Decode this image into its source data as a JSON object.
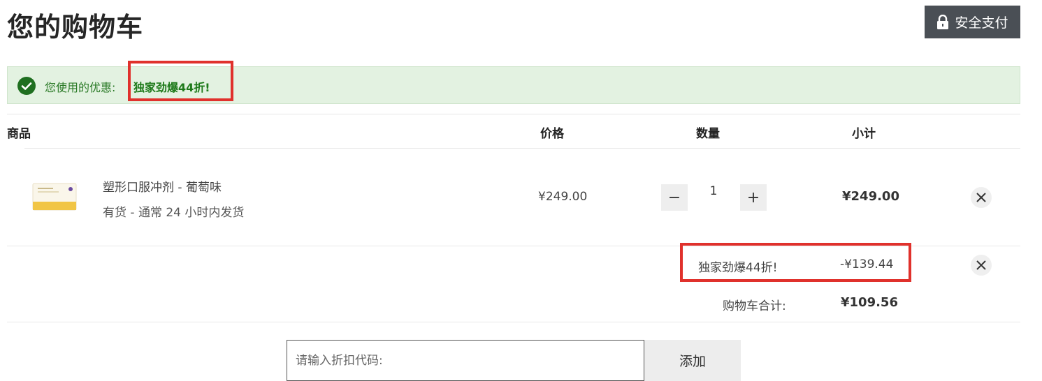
{
  "header": {
    "title": "您的购物车",
    "secure_label": "安全支付"
  },
  "banner": {
    "text": "您使用的优惠:",
    "code": "独家劲爆44折!"
  },
  "table": {
    "col_product": "商品",
    "col_price": "价格",
    "col_qty": "数量",
    "col_subtotal": "小计"
  },
  "item": {
    "name": "塑形口服冲剂 - 葡萄味",
    "stock": "有货  -  通常 24 小时内发货",
    "price": "¥249.00",
    "qty": "1",
    "subtotal": "¥249.00",
    "minus": "−",
    "plus": "+"
  },
  "discount": {
    "label": "独家劲爆44折!",
    "amount": "-¥139.44"
  },
  "total": {
    "label": "购物车合计:",
    "value": "¥109.56"
  },
  "coupon": {
    "placeholder": "请输入折扣代码:",
    "add_label": "添加"
  },
  "colors": {
    "accent_red": "#e0312c",
    "banner_bg": "#e3f2e1",
    "banner_text": "#2a7a26",
    "button_dark": "#4a4f55"
  }
}
